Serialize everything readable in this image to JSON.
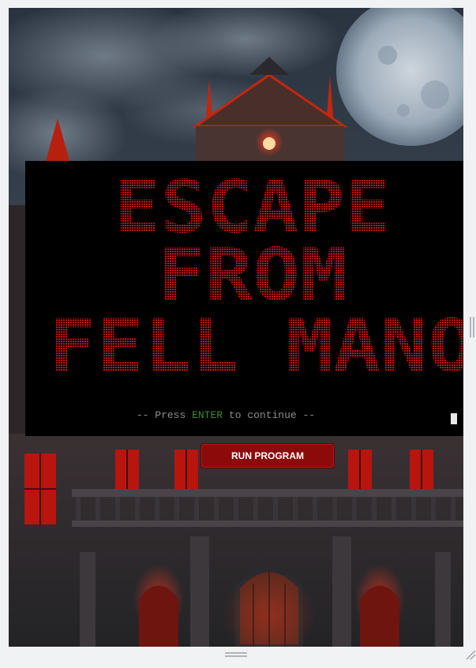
{
  "terminal": {
    "title_lines": [
      "ESCAPE",
      "FROM",
      "FELL MANOR"
    ],
    "prompt_prefix": "-- Press ",
    "prompt_key": "ENTER",
    "prompt_suffix": " to continue --"
  },
  "run_button": {
    "label": "RUN PROGRAM"
  },
  "colors": {
    "accent_red": "#d40d0d",
    "button_red": "#8c0a0a",
    "terminal_bg": "#000000",
    "prompt_gray": "#8c8c8c",
    "enter_green": "#3e8a2e"
  },
  "icons": {
    "right_handle": "resize-handle-icon",
    "bottom_handle": "resize-grip-icon",
    "corner_handle": "resize-corner-icon"
  }
}
